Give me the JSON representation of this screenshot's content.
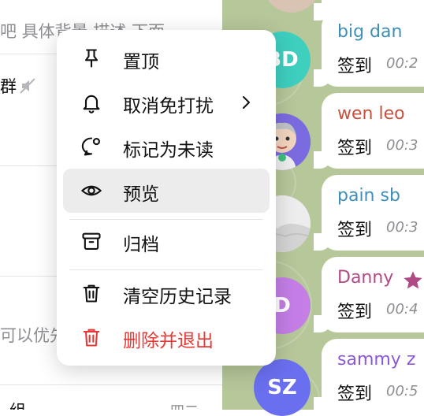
{
  "chat_list": {
    "row0_text": "吧 具体背景 描述 下面",
    "row1_title": "群",
    "row_preview": "可以优先",
    "row_bottom": "组",
    "row_bottom_right": "四二"
  },
  "context_menu": {
    "items": [
      {
        "label": "置顶",
        "icon": "pin-icon"
      },
      {
        "label": "取消免打扰",
        "icon": "bell-icon",
        "has_submenu": true
      },
      {
        "label": "标记为未读",
        "icon": "unread-bubble-icon"
      },
      {
        "label": "预览",
        "icon": "eye-icon",
        "highlighted": true
      },
      {
        "label": "归档",
        "icon": "archive-icon"
      },
      {
        "label": "清空历史记录",
        "icon": "trash-icon"
      },
      {
        "label": "删除并退出",
        "icon": "trash-red-icon",
        "danger": true
      }
    ]
  },
  "messages": [
    {
      "avatar_initials": "BD",
      "avatar_color": "#3ecfbf",
      "name": "big dan",
      "name_color": "#3f8fb8",
      "text": "签到",
      "time": "00:2"
    },
    {
      "avatar_initials": "",
      "avatar_color": "#7b6be0",
      "name": "wen leo",
      "name_color": "#c8503d",
      "text": "签到",
      "time": "00:3"
    },
    {
      "avatar_initials": "",
      "avatar_color": "#e6e6e6",
      "name": "pain sb",
      "name_color": "#3f8fb8",
      "text": "签到",
      "time": "00:3"
    },
    {
      "avatar_initials": "D",
      "avatar_color": "#c47ee6",
      "name": "Danny",
      "name_color": "#b04a86",
      "text": "签到",
      "time": "00:4"
    },
    {
      "avatar_initials": "SZ",
      "avatar_color": "#6a6ff0",
      "name": "sammy z",
      "name_color": "#8a58d8",
      "text": "签到",
      "time": "00:5"
    }
  ],
  "colors": {
    "danger": "#e53935",
    "highlight": "#ececec",
    "wallpaper": "#b6c79a"
  }
}
